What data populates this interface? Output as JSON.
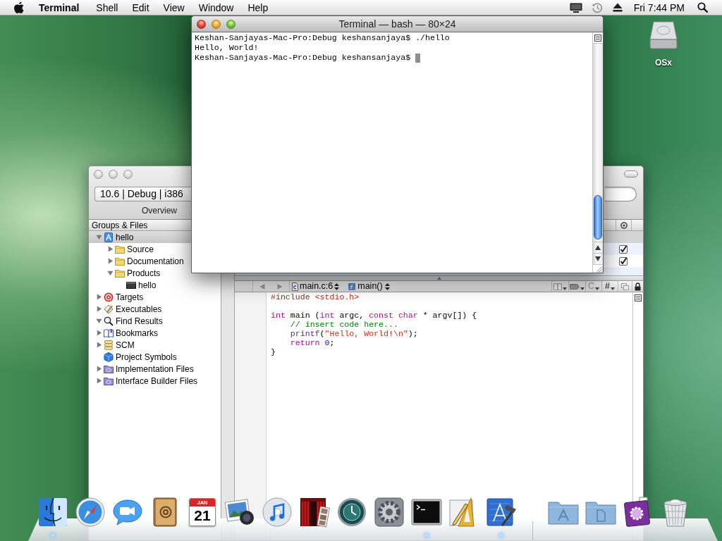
{
  "menu_bar": {
    "app_name": "Terminal",
    "menus": [
      "Shell",
      "Edit",
      "View",
      "Window",
      "Help"
    ],
    "clock": "Fri 7:44 PM"
  },
  "desktop_icons": [
    {
      "label": "OSx"
    }
  ],
  "xcode_window": {
    "active": false,
    "config_popup": "10.6 | Debug | i386",
    "toolbar_label": "Overview",
    "groups_header": "Groups & Files",
    "tree": [
      {
        "label": "hello",
        "kind": "project",
        "expanded": true,
        "selected": true,
        "children": [
          {
            "label": "Source",
            "kind": "folder",
            "expanded": false,
            "selected": false
          },
          {
            "label": "Documentation",
            "kind": "folder",
            "expanded": false,
            "selected": false
          },
          {
            "label": "Products",
            "kind": "folder",
            "expanded": true,
            "selected": false,
            "children": [
              {
                "label": "hello",
                "kind": "executable",
                "selected": false
              }
            ]
          }
        ]
      },
      {
        "label": "Targets",
        "kind": "targets",
        "expanded": false,
        "selected": false
      },
      {
        "label": "Executables",
        "kind": "executables",
        "expanded": false,
        "selected": false
      },
      {
        "label": "Find Results",
        "kind": "find",
        "expanded": true,
        "selected": false
      },
      {
        "label": "Bookmarks",
        "kind": "bookmarks",
        "expanded": false,
        "selected": false
      },
      {
        "label": "SCM",
        "kind": "scm",
        "expanded": false,
        "selected": false
      },
      {
        "label": "Project Symbols",
        "kind": "symbols",
        "selected": false
      },
      {
        "label": "Implementation Files",
        "kind": "smart_group",
        "expanded": false,
        "selected": false
      },
      {
        "label": "Interface Builder Files",
        "kind": "smart_group",
        "expanded": false,
        "selected": false
      }
    ],
    "file_table": {
      "rows": [
        {
          "selected": true
        },
        {
          "selected": false,
          "checked": true
        },
        {
          "selected": false,
          "checked": true
        }
      ]
    },
    "editor": {
      "file_popup": "main.c:6",
      "function_popup": "main()",
      "class_menu": "C",
      "include_menu": "#",
      "code": [
        {
          "kind": "code",
          "tokens": [
            {
              "kind": "preprocessor",
              "text": "#include "
            },
            {
              "kind": "header",
              "text": "<stdio.h>"
            }
          ]
        },
        {
          "kind": "blank"
        },
        {
          "kind": "code",
          "tokens": [
            {
              "kind": "keyword",
              "text": "int"
            },
            {
              "kind": "plain",
              "text": " main ("
            },
            {
              "kind": "keyword",
              "text": "int"
            },
            {
              "kind": "plain",
              "text": " argc, "
            },
            {
              "kind": "keyword",
              "text": "const char"
            },
            {
              "kind": "plain",
              "text": " * argv[]) {"
            }
          ]
        },
        {
          "kind": "code",
          "tokens": [
            {
              "kind": "comment",
              "text": "    // insert code here..."
            }
          ]
        },
        {
          "kind": "code",
          "tokens": [
            {
              "kind": "function",
              "text": "    printf"
            },
            {
              "kind": "plain",
              "text": "("
            },
            {
              "kind": "string",
              "text": "\"Hello, World!\\n\""
            },
            {
              "kind": "plain",
              "text": ");"
            }
          ]
        },
        {
          "kind": "code",
          "tokens": [
            {
              "kind": "keyword",
              "text": "    return "
            },
            {
              "kind": "number",
              "text": "0"
            },
            {
              "kind": "plain",
              "text": ";"
            }
          ]
        },
        {
          "kind": "code",
          "tokens": [
            {
              "kind": "plain",
              "text": "}"
            }
          ]
        }
      ]
    }
  },
  "terminal_window": {
    "active": true,
    "title": "Terminal — bash — 80×24",
    "lines": [
      {
        "text": "Keshan-Sanjayas-Mac-Pro:Debug keshansanjaya$ ./hello",
        "cursor": false
      },
      {
        "text": "Hello, World!",
        "cursor": false
      },
      {
        "text": "Keshan-Sanjayas-Mac-Pro:Debug keshansanjaya$",
        "cursor": true
      }
    ]
  },
  "dock": {
    "apps": [
      {
        "kind": "finder",
        "running": true
      },
      {
        "kind": "safari",
        "running": false
      },
      {
        "kind": "ichat",
        "running": false
      },
      {
        "kind": "address_book",
        "running": false
      },
      {
        "kind": "ical",
        "month": "JAN",
        "day": "21",
        "running": false
      },
      {
        "kind": "iphoto",
        "running": false
      },
      {
        "kind": "itunes",
        "running": false
      },
      {
        "kind": "photo_booth",
        "running": false
      },
      {
        "kind": "time_machine",
        "running": false
      },
      {
        "kind": "system_preferences",
        "running": false
      },
      {
        "kind": "terminal",
        "running": true
      },
      {
        "kind": "interface_builder",
        "running": false
      },
      {
        "kind": "xcode",
        "running": true
      }
    ],
    "stacks": [
      {
        "kind": "applications_folder"
      },
      {
        "kind": "documents_folder"
      },
      {
        "kind": "app_stack"
      },
      {
        "kind": "trash"
      }
    ]
  }
}
